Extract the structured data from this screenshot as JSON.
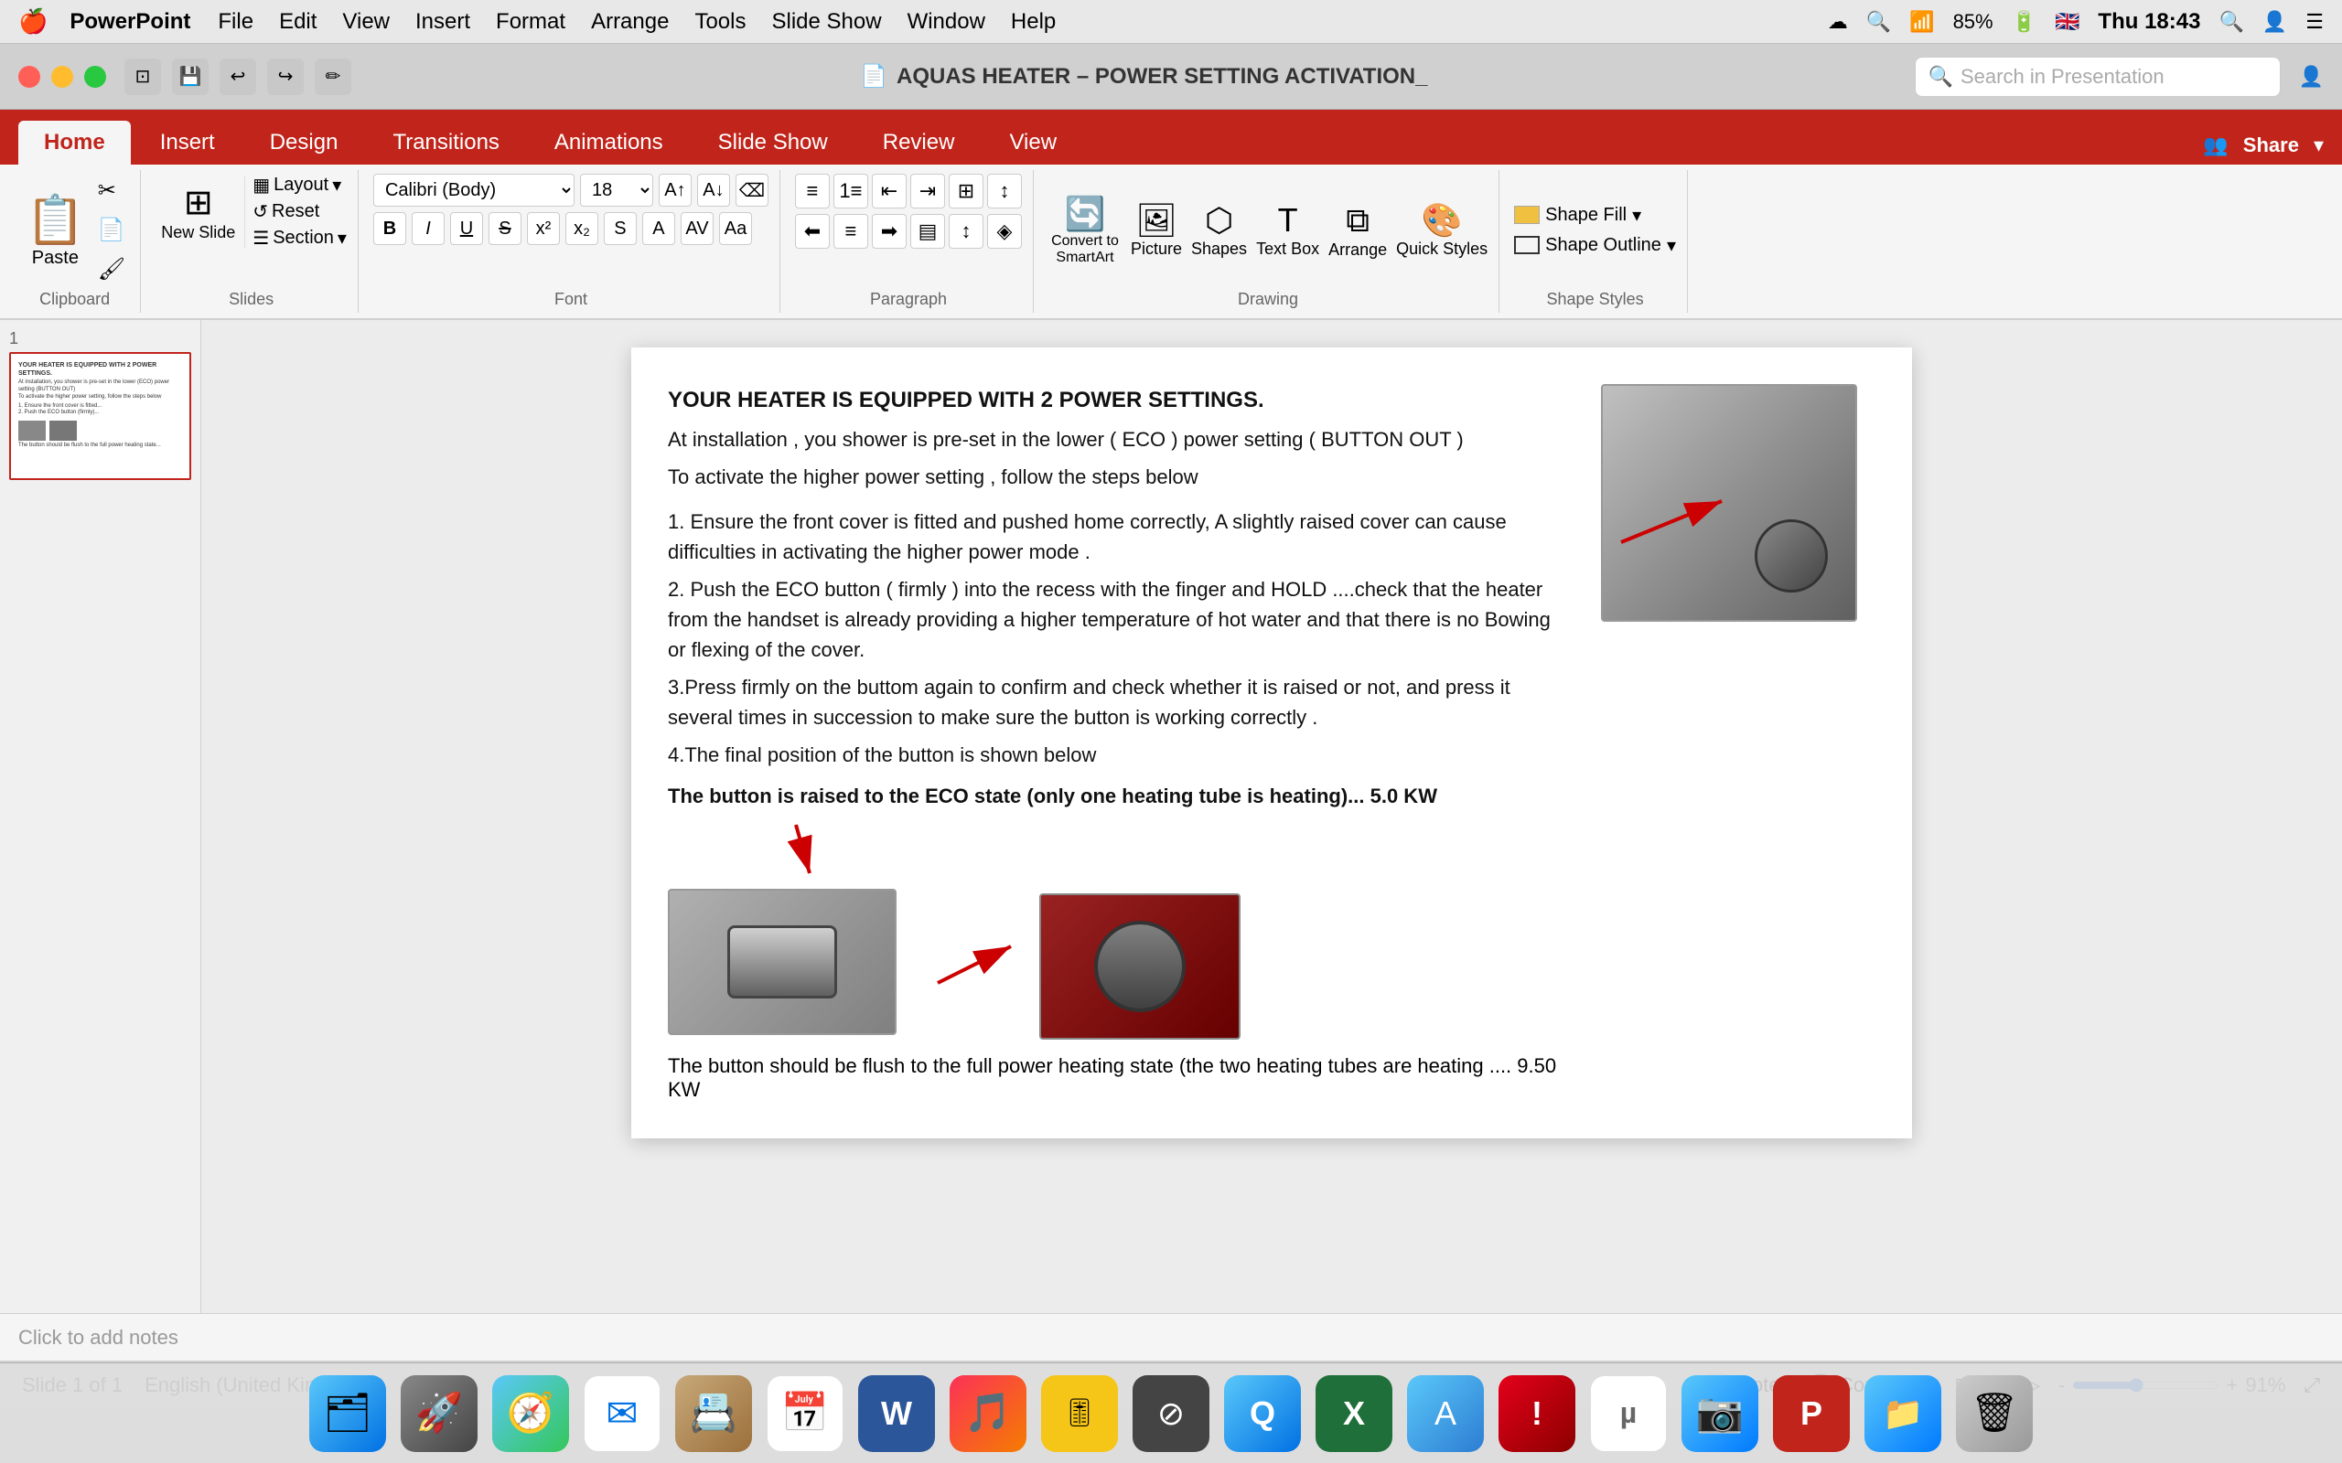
{
  "macMenubar": {
    "apple": "🍎",
    "appName": "PowerPoint",
    "menuItems": [
      "File",
      "Edit",
      "View",
      "Insert",
      "Format",
      "Arrange",
      "Tools",
      "Slide Show",
      "Window",
      "Help"
    ],
    "rightItems": [
      "☁",
      "Q",
      "⌨",
      "85%",
      "🔋",
      "🇬🇧",
      "Thu 18:43",
      "🔍",
      "👤",
      "☰"
    ]
  },
  "titleBar": {
    "title": "AQUAS HEATER – POWER SETTING ACTIVATION_",
    "searchPlaceholder": "Search in Presentation"
  },
  "ribbonTabs": [
    "Home",
    "Insert",
    "Design",
    "Transitions",
    "Animations",
    "Slide Show",
    "Review",
    "View"
  ],
  "activeTab": "Home",
  "toolbar": {
    "pasteLabel": "Paste",
    "newSlideLabel": "New Slide",
    "resetLabel": "Reset",
    "sectionLabel": "Section",
    "layoutLabel": "Layout",
    "fontFamily": "",
    "fontSize": "",
    "boldLabel": "B",
    "italicLabel": "I",
    "underlineLabel": "U",
    "convertSmartArtLabel": "Convert to SmartArt",
    "pictureLabel": "Picture",
    "shapesLabel": "Shapes",
    "textBoxLabel": "Text Box",
    "arrangeLabel": "Arrange",
    "quickStylesLabel": "Quick Styles",
    "shapeFillLabel": "Shape Fill",
    "shapeOutlineLabel": "Shape Outline"
  },
  "slide": {
    "number": "1",
    "totalSlides": "1",
    "content": {
      "heading": "YOUR HEATER IS EQUIPPED WITH 2 POWER SETTINGS.",
      "para1": "At installation , you shower is pre-set in the lower ( ECO ) power setting ( BUTTON OUT )",
      "para2": "To activate the higher power setting , follow the steps below",
      "step1": "1. Ensure the front cover is fitted and pushed home correctly, A slightly raised cover can cause difficulties in activating the higher power mode .",
      "step2": "2. Push the ECO button  ( firmly ) into the recess with the finger and HOLD ....check that the heater from the handset is already providing a higher temperature of hot water and that there is no Bowing or flexing of the cover.",
      "step3": "3.Press firmly on the buttom again to confirm and check whether it is raised or not, and press it several times in succession to make sure the button is working correctly .",
      "step4": "4.The final position of the button is shown below",
      "ecoNote": " The button is raised to the ECO state (only one heating tube is heating)... 5.0 KW",
      "flushNote": "The button should be flush to the full power heating state (the two heating tubes are heating .... 9.50 KW"
    }
  },
  "statusBar": {
    "slideInfo": "Slide 1 of 1",
    "language": "English (United Kingdom)",
    "notesLabel": "Notes",
    "commentsLabel": "Comments",
    "zoomLevel": "91%"
  },
  "notesPlaceholder": "Click to add notes",
  "dock": {
    "icons": [
      {
        "name": "finder",
        "label": "Finder",
        "emoji": "🗂"
      },
      {
        "name": "launchpad",
        "label": "Launchpad",
        "emoji": "🚀"
      },
      {
        "name": "safari",
        "label": "Safari",
        "emoji": "🧭"
      },
      {
        "name": "mail",
        "label": "Mail",
        "emoji": "✉"
      },
      {
        "name": "contacts",
        "label": "Contacts",
        "emoji": "📇"
      },
      {
        "name": "calendar",
        "label": "Calendar",
        "emoji": "📅"
      },
      {
        "name": "word",
        "label": "Word",
        "emoji": "W"
      },
      {
        "name": "itunes",
        "label": "iTunes",
        "emoji": "🎵"
      },
      {
        "name": "audacity",
        "label": "Audacity",
        "emoji": "🎚"
      },
      {
        "name": "robosub",
        "label": "Robosub",
        "emoji": "⊘"
      },
      {
        "name": "quicksilver",
        "label": "QuickSilver",
        "emoji": "Q"
      },
      {
        "name": "excel",
        "label": "Excel",
        "emoji": "X"
      },
      {
        "name": "appstore",
        "label": "App Store",
        "emoji": "A"
      },
      {
        "name": "issues",
        "label": "Issues",
        "emoji": "!"
      },
      {
        "name": "utorrent",
        "label": "uTorrent",
        "emoji": "µ"
      },
      {
        "name": "iphoto",
        "label": "iPhoto",
        "emoji": "📷"
      },
      {
        "name": "powerpoint",
        "label": "PowerPoint",
        "emoji": "P"
      },
      {
        "name": "files",
        "label": "Files",
        "emoji": "📁"
      },
      {
        "name": "trash",
        "label": "Trash",
        "emoji": "🗑"
      }
    ]
  }
}
